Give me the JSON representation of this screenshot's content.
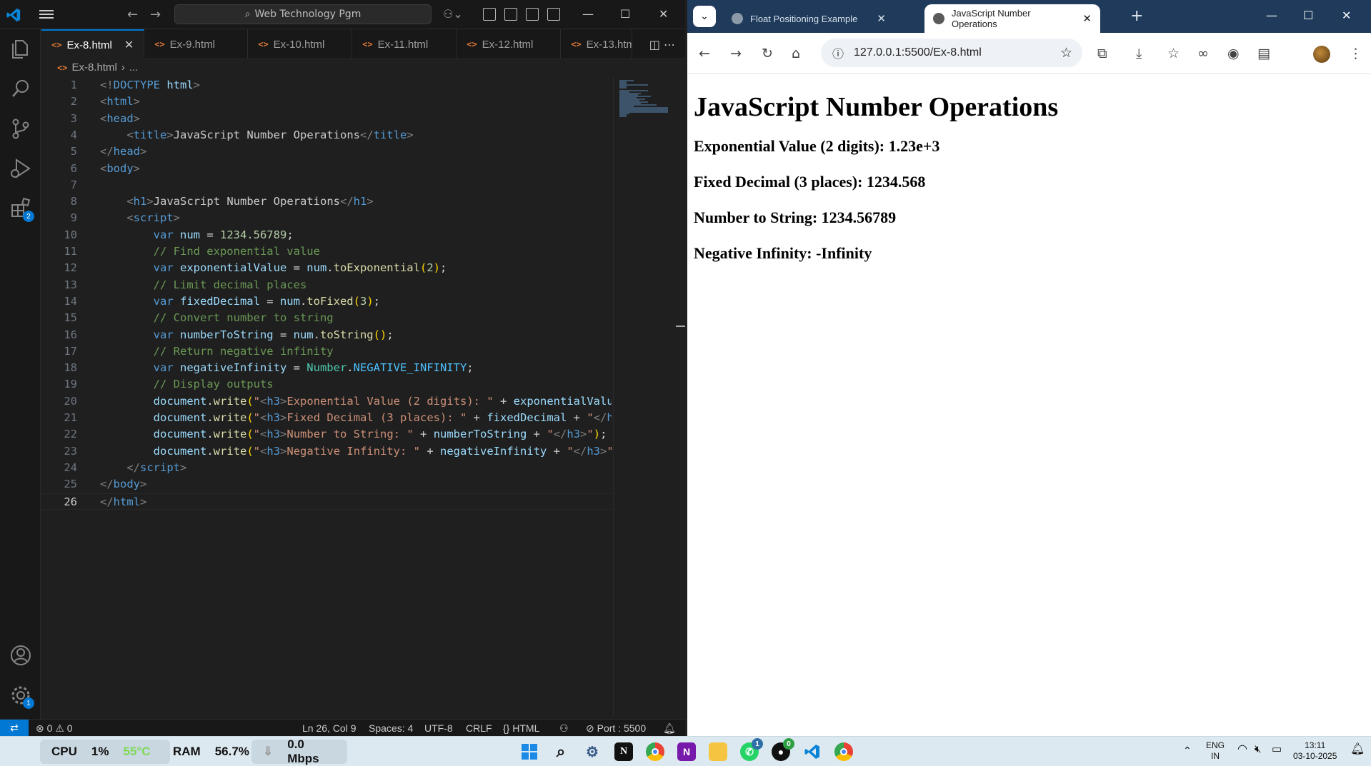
{
  "vscode": {
    "search_text": "Web Technology Pgm",
    "tabs": [
      {
        "label": "Ex-8.html",
        "active": true
      },
      {
        "label": "Ex-9.html"
      },
      {
        "label": "Ex-10.html"
      },
      {
        "label": "Ex-11.html"
      },
      {
        "label": "Ex-12.html"
      },
      {
        "label": "Ex-13.htm"
      }
    ],
    "breadcrumb": {
      "file": "Ex-8.html",
      "more": "..."
    },
    "activity_badges": {
      "extensions": "2",
      "manage": "1"
    },
    "line_numbers": [
      "1",
      "2",
      "3",
      "4",
      "5",
      "6",
      "7",
      "8",
      "9",
      "10",
      "11",
      "12",
      "13",
      "14",
      "15",
      "16",
      "17",
      "18",
      "19",
      "20",
      "21",
      "22",
      "23",
      "24",
      "25",
      "26"
    ],
    "status": {
      "errors": "0",
      "warnings": "0",
      "position": "Ln 26, Col 9",
      "spaces": "Spaces: 4",
      "encoding": "UTF-8",
      "eol": "CRLF",
      "language": "HTML",
      "port": "Port : 5500"
    }
  },
  "chrome": {
    "tabs": [
      {
        "label": "Float Positioning Example"
      },
      {
        "label": "JavaScript Number Operations",
        "active": true
      }
    ],
    "url": "127.0.0.1:5500/Ex-8.html",
    "page": {
      "heading": "JavaScript Number Operations",
      "lines": [
        "Exponential Value (2 digits): 1.23e+3",
        "Fixed Decimal (3 places): 1234.568",
        "Number to String: 1234.56789",
        "Negative Infinity: -Infinity"
      ]
    }
  },
  "taskbar": {
    "cpu_label": "CPU",
    "cpu_value": "1%",
    "cpu_temp": "55°C",
    "ram_label": "RAM",
    "ram_value": "56.7%",
    "net_value": "0.0 Mbps",
    "lang_top": "ENG",
    "lang_bottom": "IN",
    "time": "13:11",
    "date": "03-10-2025",
    "whatsapp_badge": "1",
    "github_badge": "0"
  },
  "colors": {
    "vscode_bg": "#1f1f1f",
    "accent": "#0078d4",
    "chrome_tabbar": "#1f3a5a",
    "taskbar_bg": "#dde9f0"
  }
}
